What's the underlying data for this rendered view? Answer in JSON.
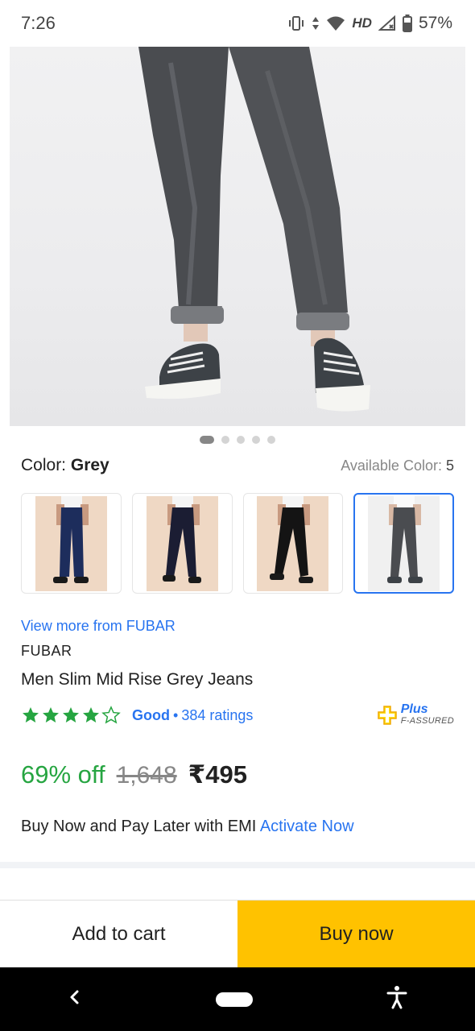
{
  "status_bar": {
    "time": "7:26",
    "network_label": "HD",
    "battery": "57%"
  },
  "gallery": {
    "image_count": 5,
    "active_index": 0
  },
  "color": {
    "label": "Color:",
    "value": "Grey",
    "available_label": "Available Color:",
    "available_count": "5",
    "swatches": [
      {
        "name": "navy-jeans",
        "selected": false
      },
      {
        "name": "dark-blue-jeans",
        "selected": false
      },
      {
        "name": "black-jeans",
        "selected": false
      },
      {
        "name": "grey-jeans",
        "selected": true
      }
    ]
  },
  "product": {
    "view_more": "View more from FUBAR",
    "brand": "FUBAR",
    "title": "Men Slim Mid Rise Grey Jeans",
    "rating_stars": 4,
    "rating_text": "Good",
    "ratings_count": "384 ratings",
    "assured_word": "Plus",
    "assured_sub": "F-ASSURED"
  },
  "pricing": {
    "discount": "69% off",
    "mrp": "1,648",
    "price": "₹495"
  },
  "emi": {
    "text": "Buy Now and Pay Later with EMI",
    "link": "Activate Now"
  },
  "cta": {
    "add_to_cart": "Add to cart",
    "buy_now": "Buy now"
  },
  "colors": {
    "accent_blue": "#2874f0",
    "discount_green": "#26a541",
    "buy_yellow": "#ffc200",
    "star_green": "#26a541"
  }
}
